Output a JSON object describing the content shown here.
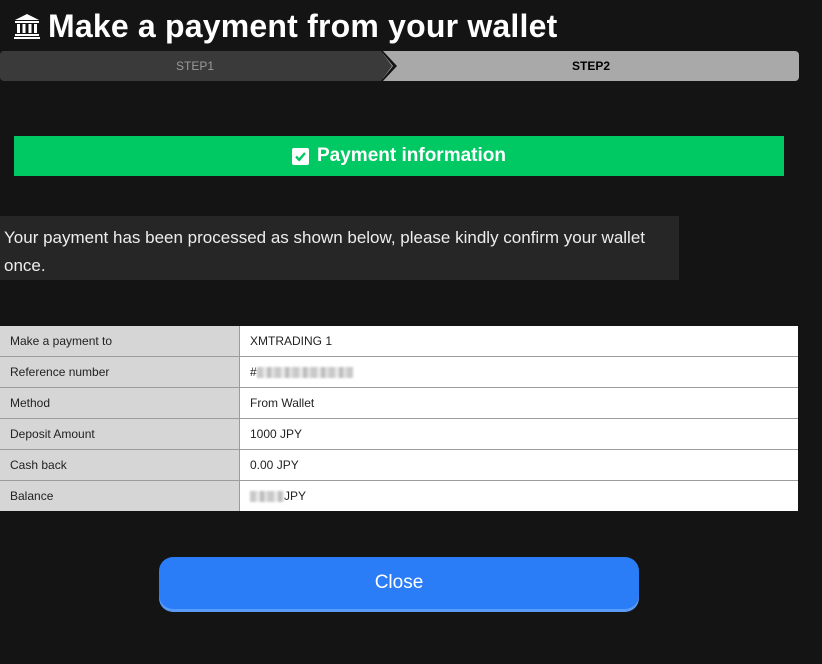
{
  "header": {
    "title": "Make a payment from your wallet",
    "icon": "bank-icon"
  },
  "steps": {
    "step1_label": "STEP1",
    "step2_label": "STEP2",
    "active": "STEP2"
  },
  "banner": {
    "icon": "checkbox-checked-icon",
    "label": "Payment information",
    "color": "#00c964"
  },
  "message": {
    "text": "Your payment has been processed as shown below, please kindly confirm your wallet once."
  },
  "table": {
    "rows": [
      {
        "label": "Make a payment to",
        "value": "XMTRADING 1"
      },
      {
        "label": "Reference number",
        "value": "#"
      },
      {
        "label": "Method",
        "value": "From Wallet"
      },
      {
        "label": "Deposit Amount",
        "value": "1000 JPY"
      },
      {
        "label": "Cash back",
        "value": "0.00 JPY"
      },
      {
        "label": "Balance",
        "value": "JPY"
      }
    ]
  },
  "footer": {
    "close_label": "Close",
    "button_color": "#2a7cf7"
  }
}
